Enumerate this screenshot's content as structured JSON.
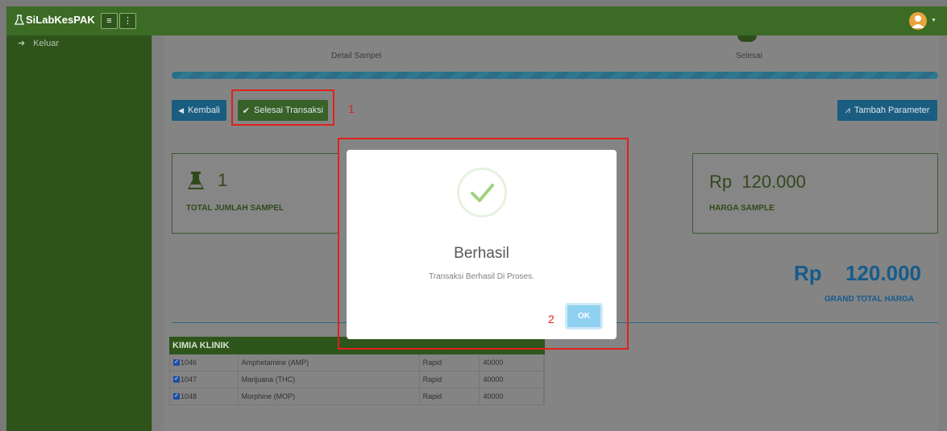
{
  "app": {
    "name": "SiLabKesPAK"
  },
  "topbar": {
    "menu_icon": "bars-icon",
    "more_icon": "vertical-dots-icon",
    "user_icon": "user-avatar-icon"
  },
  "sidebar": {
    "items": [
      {
        "label": "Keluar",
        "icon": "sign-out-icon"
      }
    ]
  },
  "steps": [
    {
      "label": "Detail Sampel"
    },
    {
      "label": "Selesai"
    }
  ],
  "toolbar": {
    "back_label": "Kembali",
    "finish_label": "Selesai Transaksi",
    "add_param_label": "Tambah Parameter"
  },
  "annotations": {
    "one": "1",
    "two": "2"
  },
  "cards": {
    "samples": {
      "value": "1",
      "caption": "TOTAL JUMLAH SAMPEL"
    },
    "price": {
      "value": "Rp  120.000",
      "caption": "HARGA SAMPLE"
    }
  },
  "grand_total": {
    "currency": "Rp",
    "value": "120.000",
    "caption": "GRAND TOTAL HARGA"
  },
  "table": {
    "title": "KIMIA KLINIK",
    "rows": [
      {
        "code": "1046",
        "name": "Amphetamine (AMP)",
        "method": "Rapid",
        "price": "40000",
        "checked": true
      },
      {
        "code": "1047",
        "name": "Marijuana (THC)",
        "method": "Rapid",
        "price": "40000",
        "checked": true
      },
      {
        "code": "1048",
        "name": "Morphine (MOP)",
        "method": "Rapid",
        "price": "40000",
        "checked": true
      }
    ]
  },
  "modal": {
    "title": "Berhasil",
    "message": "Transaksi Berhasil Di Proses.",
    "ok_label": "OK"
  },
  "colors": {
    "topbar": "#3b6b24",
    "sidebar": "#2e531b",
    "accent_blue": "#165b8c",
    "highlight_red": "#e0211b",
    "ok_button": "#8fd1f0"
  }
}
